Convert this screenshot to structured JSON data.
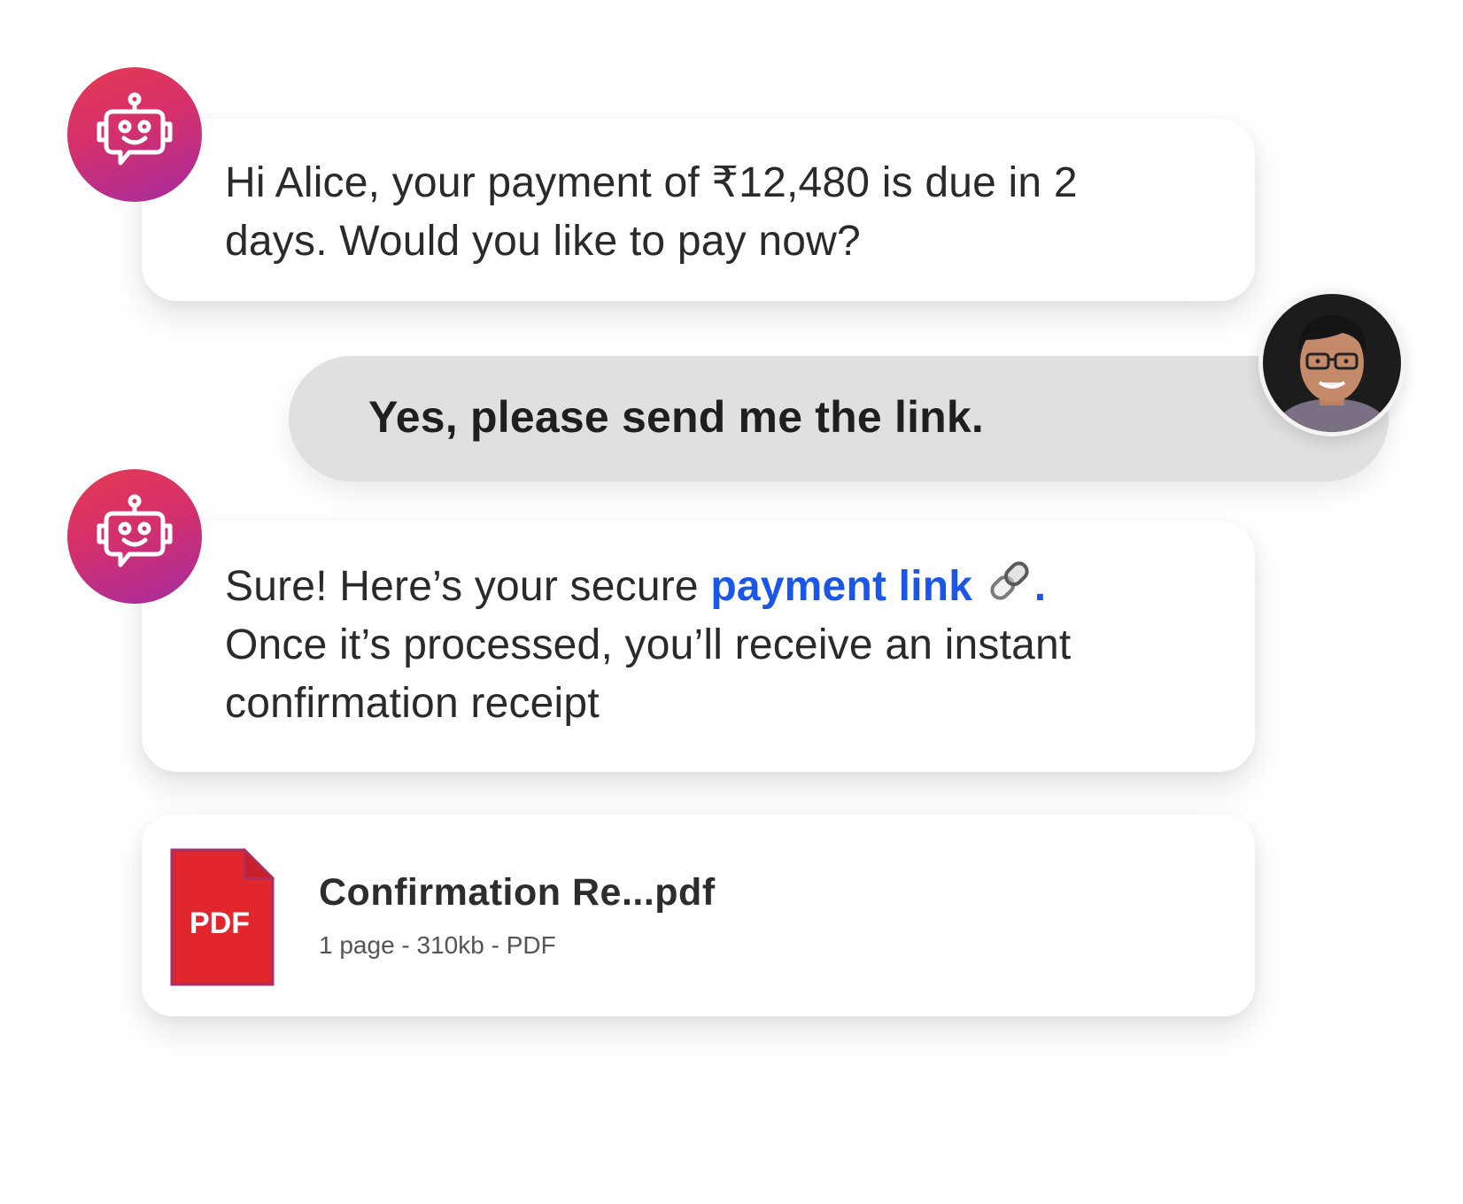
{
  "conversation": {
    "message_1": {
      "sender": "bot",
      "text_line_1": "Hi Alice, your payment of ₹12,480 is due in 2",
      "text_line_2": "days. Would you like to pay now?"
    },
    "message_2": {
      "sender": "user",
      "text": "Yes, please send me the link."
    },
    "message_3": {
      "sender": "bot",
      "prefix": "Sure! Here’s your secure ",
      "link_label": "payment link",
      "link_suffix": ".",
      "line_2": "Once it’s processed, you’ll receive an instant",
      "line_3": "confirmation receipt"
    },
    "attachment": {
      "icon_label": "PDF",
      "file_name": "Confirmation Re...pdf",
      "meta": "1 page - 310kb - PDF"
    }
  },
  "icons": {
    "bot_avatar": "robot-chat-icon",
    "user_avatar": "user-photo",
    "link": "chain-link-icon",
    "file": "pdf-file-icon"
  },
  "colors": {
    "bot_gradient_start": "#e53a52",
    "bot_gradient_end": "#a52ca0",
    "link": "#1a56e8",
    "user_bubble": "#e0e0e0",
    "pdf_red": "#e1262e",
    "pdf_border": "#a8306a"
  }
}
